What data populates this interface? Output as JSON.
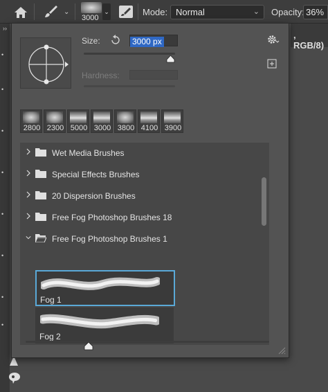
{
  "options_bar": {
    "brush_preset_size": "3000",
    "mode_label": "Mode:",
    "mode_value": "Normal",
    "opacity_label": "Opacity:",
    "opacity_value": "36%"
  },
  "document_tab": {
    "partial_title": ", RGB/8)"
  },
  "brush_panel": {
    "size_label": "Size:",
    "size_value": "3000 px",
    "size_slider_fraction": 0.9,
    "hardness_label": "Hardness:",
    "recent_brushes": [
      {
        "size": "2800",
        "kind": "soft"
      },
      {
        "size": "2300",
        "kind": "soft"
      },
      {
        "size": "5000",
        "kind": "cloud"
      },
      {
        "size": "3000",
        "kind": "cloud"
      },
      {
        "size": "3800",
        "kind": "soft"
      },
      {
        "size": "4100",
        "kind": "cloud"
      },
      {
        "size": "3900",
        "kind": "cloud"
      }
    ],
    "folders": [
      {
        "name": "Wet Media Brushes",
        "expanded": false
      },
      {
        "name": "Special Effects Brushes",
        "expanded": false
      },
      {
        "name": "20 Dispersion Brushes",
        "expanded": false
      },
      {
        "name": "Free Fog Photoshop Brushes 18",
        "expanded": false
      },
      {
        "name": "Free Fog Photoshop Brushes 1",
        "expanded": true
      }
    ],
    "brushes": [
      {
        "name": "Fog 1",
        "selected": true
      },
      {
        "name": "Fog 2",
        "selected": false
      }
    ],
    "preview_slider_fraction": 0.27
  },
  "colors": {
    "panel_bg": "#535353",
    "selection_highlight": "#2f68c4",
    "selected_border": "#5aa9d8"
  }
}
